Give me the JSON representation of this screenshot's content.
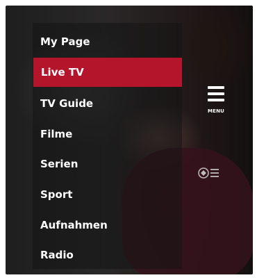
{
  "menu": {
    "items": [
      {
        "label": "My Page",
        "active": false
      },
      {
        "label": "Live TV",
        "active": true
      },
      {
        "label": "TV Guide",
        "active": false
      },
      {
        "label": "Filme",
        "active": false
      },
      {
        "label": "Serien",
        "active": false
      },
      {
        "label": "Sport",
        "active": false
      },
      {
        "label": "Aufnahmen",
        "active": false
      },
      {
        "label": "Radio",
        "active": false
      }
    ],
    "button_label": "MENU",
    "button_icon": "hamburger-icon"
  },
  "colors": {
    "active_item": "#b5152b",
    "text": "#ffffff"
  }
}
